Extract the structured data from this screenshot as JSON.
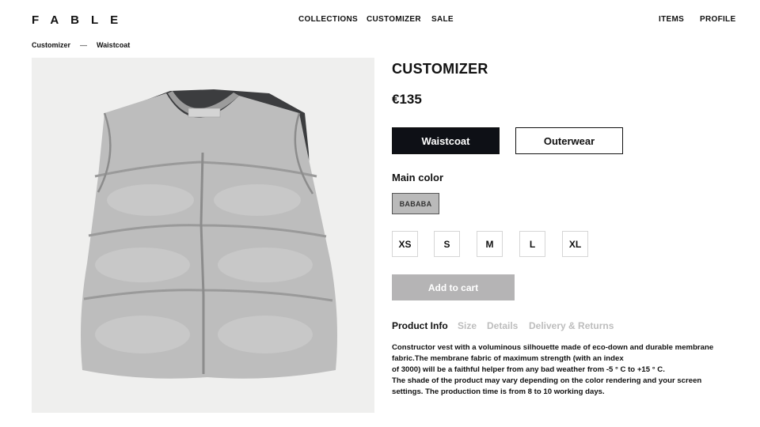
{
  "brand": {
    "logo_text": "FABLE"
  },
  "nav": {
    "collections": "COLLECTIONS",
    "customizer": "CUSTOMIZER",
    "sale": "SALE",
    "items": "ITEMS",
    "profile": "PROFILE"
  },
  "breadcrumb": {
    "root": "Customizer",
    "separator": "—",
    "current": "Waistcoat"
  },
  "product": {
    "title": "CUSTOMIZER",
    "price": "€135",
    "variants": [
      {
        "label": "Waistcoat",
        "selected": true
      },
      {
        "label": "Outerwear",
        "selected": false
      }
    ],
    "color_label": "Main color",
    "color_value": "BABABA",
    "color_hex": "#BABABA",
    "sizes": [
      "XS",
      "S",
      "M",
      "L",
      "XL"
    ],
    "add_to_cart": "Add to cart",
    "tabs": [
      "Product Info",
      "Size",
      "Details",
      "Delivery & Returns"
    ],
    "active_tab": "Product Info",
    "description_lines": [
      "Constructor vest with a voluminous silhouette made of eco-down and durable membrane",
      "fabric.The membrane fabric of maximum strength (with an index",
      "of 3000) will be a faithful helper from any bad weather from -5 ° C to +15 ° C.",
      "The shade of the product may vary depending on the color rendering and your screen",
      "settings. The production time is from 8 to 10 working days."
    ]
  },
  "colors": {
    "accent_dark": "#0E1016",
    "cart_disabled": "#B5B4B5",
    "image_bg": "#EFEFEE",
    "muted_tab": "#BDBDBD"
  }
}
